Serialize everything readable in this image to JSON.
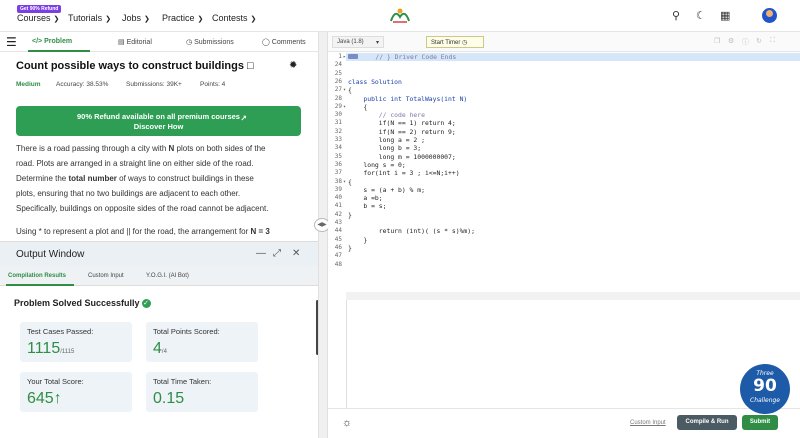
{
  "nav": {
    "promo_badge": "Get 90% Refund",
    "items": [
      "Courses",
      "Tutorials",
      "Jobs",
      "Practice",
      "Contests"
    ]
  },
  "left_tabs": [
    {
      "label": "Problem",
      "icon": "code-icon"
    },
    {
      "label": "Editorial",
      "icon": "document-icon"
    },
    {
      "label": "Submissions",
      "icon": "clock-icon"
    },
    {
      "label": "Comments",
      "icon": "comment-icon"
    }
  ],
  "problem": {
    "title": "Count possible ways to construct buildings",
    "difficulty": "Medium",
    "accuracy": "Accuracy: 38.53%",
    "submissions": "Submissions: 39K+",
    "points": "Points: 4",
    "refund_line1": "90% Refund available on all premium courses",
    "refund_line2": "Discover How",
    "desc": [
      {
        "parts": [
          "There is a road passing through a city with ",
          "N",
          " plots on both sides of the"
        ]
      },
      {
        "parts": [
          "road. Plots are arranged in a straight line on either side of the road.",
          "",
          ""
        ]
      },
      {
        "parts": [
          "Determine the ",
          "total number",
          " of ways to construct buildings in these"
        ]
      },
      {
        "parts": [
          "plots, ensuring that no two buildings are adjacent to each other.",
          "",
          ""
        ]
      },
      {
        "parts": [
          "Specifically, buildings on opposite sides of the road cannot be adjacent.",
          "",
          ""
        ]
      },
      {
        "parts": [
          "Using * to represent a plot and || for the road, the arrangement for ",
          "N = 3",
          ""
        ]
      }
    ]
  },
  "output": {
    "title": "Output Window",
    "tabs": [
      "Compilation Results",
      "Custom Input",
      "Y.O.G.I. (AI Bot)"
    ],
    "status": "Problem Solved Successfully",
    "cards": [
      {
        "label": "Test Cases Passed:",
        "value": "1115",
        "suffix": "/1115"
      },
      {
        "label": "Total Points Scored:",
        "value": "4",
        "suffix": "/4"
      },
      {
        "label": "Your Total Score:",
        "value": "645",
        "suffix": "↑"
      },
      {
        "label": "Total Time Taken:",
        "value": "0.15",
        "suffix": ""
      }
    ]
  },
  "editor": {
    "language": "Java (1.8)",
    "timer_label": "Start Timer",
    "lines": [
      {
        "n": "1",
        "fold": "▸",
        "text": "    // } Driver Code Ends",
        "cls": "cm"
      },
      {
        "n": "24",
        "fold": "",
        "text": "",
        "cls": ""
      },
      {
        "n": "25",
        "fold": "",
        "text": "",
        "cls": ""
      },
      {
        "n": "26",
        "fold": "",
        "text": "class Solution",
        "cls": "kw"
      },
      {
        "n": "27",
        "fold": "▾",
        "text": "{",
        "cls": ""
      },
      {
        "n": "28",
        "fold": "",
        "text": "    public int TotalWays(int N)",
        "cls": "kw"
      },
      {
        "n": "29",
        "fold": "▾",
        "text": "    {",
        "cls": ""
      },
      {
        "n": "30",
        "fold": "",
        "text": "        // code here",
        "cls": "cm"
      },
      {
        "n": "31",
        "fold": "",
        "text": "        if(N == 1) return 4;",
        "cls": ""
      },
      {
        "n": "32",
        "fold": "",
        "text": "        if(N == 2) return 9;",
        "cls": ""
      },
      {
        "n": "33",
        "fold": "",
        "text": "        long a = 2 ;",
        "cls": ""
      },
      {
        "n": "34",
        "fold": "",
        "text": "        long b = 3;",
        "cls": ""
      },
      {
        "n": "35",
        "fold": "",
        "text": "        long m = 1000000007;",
        "cls": ""
      },
      {
        "n": "36",
        "fold": "",
        "text": "    long s = 0;",
        "cls": ""
      },
      {
        "n": "37",
        "fold": "",
        "text": "    for(int i = 3 ; i<=N;i++)",
        "cls": ""
      },
      {
        "n": "38",
        "fold": "▾",
        "text": "{",
        "cls": ""
      },
      {
        "n": "39",
        "fold": "",
        "text": "    s = (a + b) % m;",
        "cls": ""
      },
      {
        "n": "40",
        "fold": "",
        "text": "    a =b;",
        "cls": ""
      },
      {
        "n": "41",
        "fold": "",
        "text": "    b = s;",
        "cls": ""
      },
      {
        "n": "42",
        "fold": "",
        "text": "}",
        "cls": ""
      },
      {
        "n": "43",
        "fold": "",
        "text": "",
        "cls": ""
      },
      {
        "n": "44",
        "fold": "",
        "text": "        return (int)( (s * s)%m);",
        "cls": ""
      },
      {
        "n": "45",
        "fold": "",
        "text": "    }",
        "cls": ""
      },
      {
        "n": "46",
        "fold": "",
        "text": "}",
        "cls": ""
      },
      {
        "n": "47",
        "fold": "",
        "text": "",
        "cls": ""
      },
      {
        "n": "48",
        "fold": "",
        "text": "",
        "cls": ""
      }
    ],
    "custom_input": "Custom Input",
    "compile_label": "Compile & Run",
    "submit_label": "Submit"
  },
  "promo90": {
    "line1": "Three",
    "line2": "90",
    "line3": "Challenge"
  }
}
